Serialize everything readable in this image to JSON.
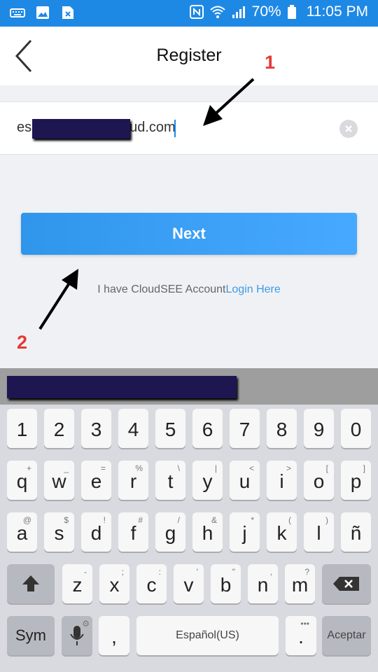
{
  "status_bar": {
    "battery": "70%",
    "time": "11:05 PM",
    "icons": [
      "keyboard-icon",
      "image-icon",
      "file-x-icon",
      "nfc-icon",
      "wifi-icon",
      "signal-icon",
      "battery-icon"
    ]
  },
  "header": {
    "title": "Register",
    "back_icon": "chevron-left-icon"
  },
  "email": {
    "prefix": "es",
    "suffix": "ud.com",
    "clear_icon": "clear-icon"
  },
  "next_label": "Next",
  "account": {
    "text": "I have CloudSEE Account",
    "link": "Login Here"
  },
  "annotations": {
    "one": "1",
    "two": "2"
  },
  "colors": {
    "status_bar": "#1e88e5",
    "button": "#3a9ef0",
    "link": "#3d9be8",
    "annotation": "#e53935",
    "redaction": "#1d1650"
  },
  "keyboard": {
    "numbers": [
      "1",
      "2",
      "3",
      "4",
      "5",
      "6",
      "7",
      "8",
      "9",
      "0"
    ],
    "row1": [
      {
        "k": "q",
        "s": "+"
      },
      {
        "k": "w",
        "s": "_"
      },
      {
        "k": "e",
        "s": "="
      },
      {
        "k": "r",
        "s": "%"
      },
      {
        "k": "t",
        "s": "\\"
      },
      {
        "k": "y",
        "s": "|"
      },
      {
        "k": "u",
        "s": "<"
      },
      {
        "k": "i",
        "s": ">"
      },
      {
        "k": "o",
        "s": "["
      },
      {
        "k": "p",
        "s": "]"
      }
    ],
    "row2": [
      {
        "k": "a",
        "s": "@"
      },
      {
        "k": "s",
        "s": "$"
      },
      {
        "k": "d",
        "s": "!"
      },
      {
        "k": "f",
        "s": "#"
      },
      {
        "k": "g",
        "s": "/"
      },
      {
        "k": "h",
        "s": "&"
      },
      {
        "k": "j",
        "s": "*"
      },
      {
        "k": "k",
        "s": "("
      },
      {
        "k": "l",
        "s": ")"
      },
      {
        "k": "ñ",
        "s": ""
      }
    ],
    "row3": [
      {
        "k": "z",
        "s": "-"
      },
      {
        "k": "x",
        "s": ";"
      },
      {
        "k": "c",
        "s": ":"
      },
      {
        "k": "v",
        "s": "'"
      },
      {
        "k": "b",
        "s": "\""
      },
      {
        "k": "n",
        "s": ","
      },
      {
        "k": "m",
        "s": "?"
      }
    ],
    "sym": "Sym",
    "comma": ",",
    "space": "Español(US)",
    "period": ".",
    "accept": "Aceptar"
  }
}
